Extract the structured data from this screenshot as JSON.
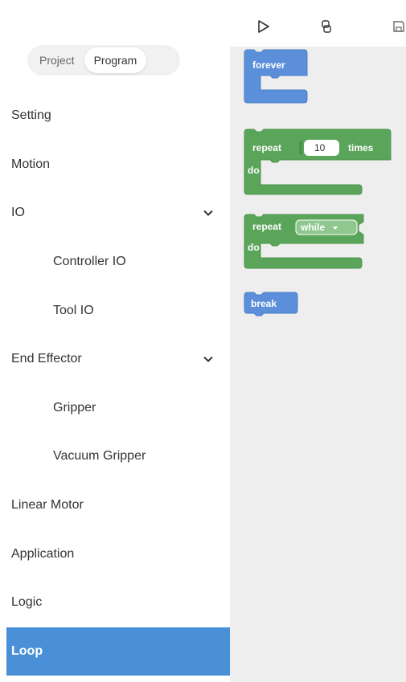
{
  "tabs": [
    {
      "label": "Project",
      "active": false
    },
    {
      "label": "Program",
      "active": true
    }
  ],
  "nav": [
    {
      "label": "Setting",
      "sub": false
    },
    {
      "label": "Motion",
      "sub": false
    },
    {
      "label": "IO",
      "sub": false,
      "expanded": true
    },
    {
      "label": "Controller IO",
      "sub": true
    },
    {
      "label": "Tool IO",
      "sub": true
    },
    {
      "label": "End Effector",
      "sub": false,
      "expanded": true
    },
    {
      "label": "Gripper",
      "sub": true
    },
    {
      "label": "Vacuum Gripper",
      "sub": true
    },
    {
      "label": "Linear Motor",
      "sub": false
    },
    {
      "label": "Application",
      "sub": false
    },
    {
      "label": "Logic",
      "sub": false
    },
    {
      "label": "Loop",
      "sub": false,
      "active": true
    }
  ],
  "toolbar": {
    "icons": [
      "play-icon",
      "redo-icon",
      "save-icon"
    ]
  },
  "blocks": {
    "forever": {
      "label": "forever"
    },
    "repeat_times": {
      "label": "repeat",
      "count": "10",
      "unit": "times",
      "do": "do"
    },
    "repeat_while": {
      "label": "repeat",
      "mode": "while",
      "do": "do"
    },
    "break": {
      "label": "break"
    }
  },
  "colors": {
    "sidebar_active": "#4a90d9",
    "block_loop_blue": "#5b8fd9",
    "block_repeat_green": "#5ba55b",
    "workspace_bg": "#eeeeee"
  }
}
